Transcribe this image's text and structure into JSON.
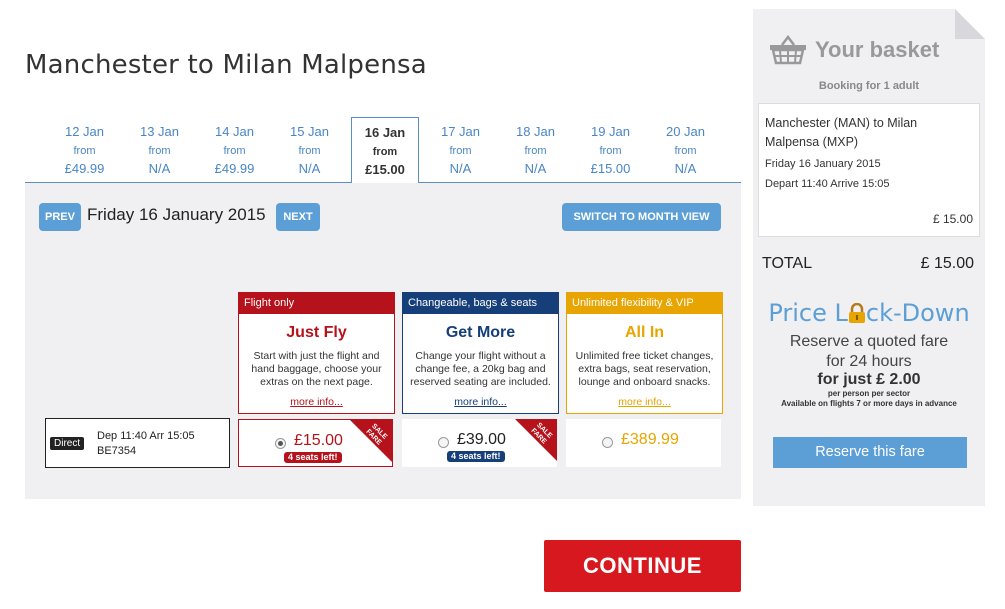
{
  "route_title": "Manchester to Milan Malpensa",
  "date_tabs": [
    {
      "date": "12 Jan",
      "from": "from",
      "price": "£49.99"
    },
    {
      "date": "13 Jan",
      "from": "from",
      "price": "N/A"
    },
    {
      "date": "14 Jan",
      "from": "from",
      "price": "£49.99"
    },
    {
      "date": "15 Jan",
      "from": "from",
      "price": "N/A"
    },
    {
      "date": "16 Jan",
      "from": "from",
      "price": "£15.00"
    },
    {
      "date": "17 Jan",
      "from": "from",
      "price": "N/A"
    },
    {
      "date": "18 Jan",
      "from": "from",
      "price": "N/A"
    },
    {
      "date": "19 Jan",
      "from": "from",
      "price": "£15.00"
    },
    {
      "date": "20 Jan",
      "from": "from",
      "price": "N/A"
    }
  ],
  "day_nav": {
    "prev_label": "PREV",
    "day_label": "Friday 16 January 2015",
    "next_label": "NEXT",
    "switch_label": "SWITCH TO MONTH VIEW"
  },
  "fares": [
    {
      "header": "Flight only",
      "name": "Just Fly",
      "description": "Start with just the flight and hand baggage, choose your extras on the next page.",
      "more": "more info..."
    },
    {
      "header": "Changeable, bags & seats",
      "name": "Get More",
      "description": "Change your flight without a change fee, a 20kg bag and reserved seating are included.",
      "more": "more info..."
    },
    {
      "header": "Unlimited flexibility & VIP",
      "name": "All In",
      "description": "Unlimited free ticket changes, extra bags, seat reservation, lounge and onboard snacks.",
      "more": "more info..."
    }
  ],
  "flight": {
    "badge": "Direct",
    "times": "Dep 11:40 Arr 15:05",
    "number": "BE7354"
  },
  "prices": [
    {
      "price": "£15.00",
      "seats": "4 seats left!",
      "ribbon": "SALE FARE",
      "color": "#b5121b"
    },
    {
      "price": "£39.00",
      "seats": "4 seats left!",
      "ribbon": "SALE FARE",
      "color": "#222222"
    },
    {
      "price": "£389.99",
      "color": "#e8a400"
    }
  ],
  "continue_label": "CONTINUE",
  "basket": {
    "title": "Your basket",
    "booking_for": "Booking for 1 adult",
    "route": "Manchester (MAN) to Milan Malpensa (MXP)",
    "date": "Friday 16 January 2015",
    "times": "Depart 11:40 Arrive 15:05",
    "price": "£ 15.00",
    "total_label": "TOTAL",
    "total_value": "£ 15.00"
  },
  "lockdown": {
    "title_pre": "Price L",
    "title_post": "ck-Down",
    "line1": "Reserve a quoted fare",
    "line2": "for 24 hours",
    "price": "for just £ 2.00",
    "per": "per person per sector",
    "avail": "Available on flights 7 or more days in advance",
    "button": "Reserve this fare"
  },
  "colors": {
    "accent_blue": "#5b9fd6",
    "brand_red": "#d7191f",
    "just_fly_red": "#b5121b",
    "get_more_navy": "#163f7a",
    "all_in_gold": "#e8a400"
  },
  "icons": [
    "basket-icon",
    "padlock-icon"
  ]
}
